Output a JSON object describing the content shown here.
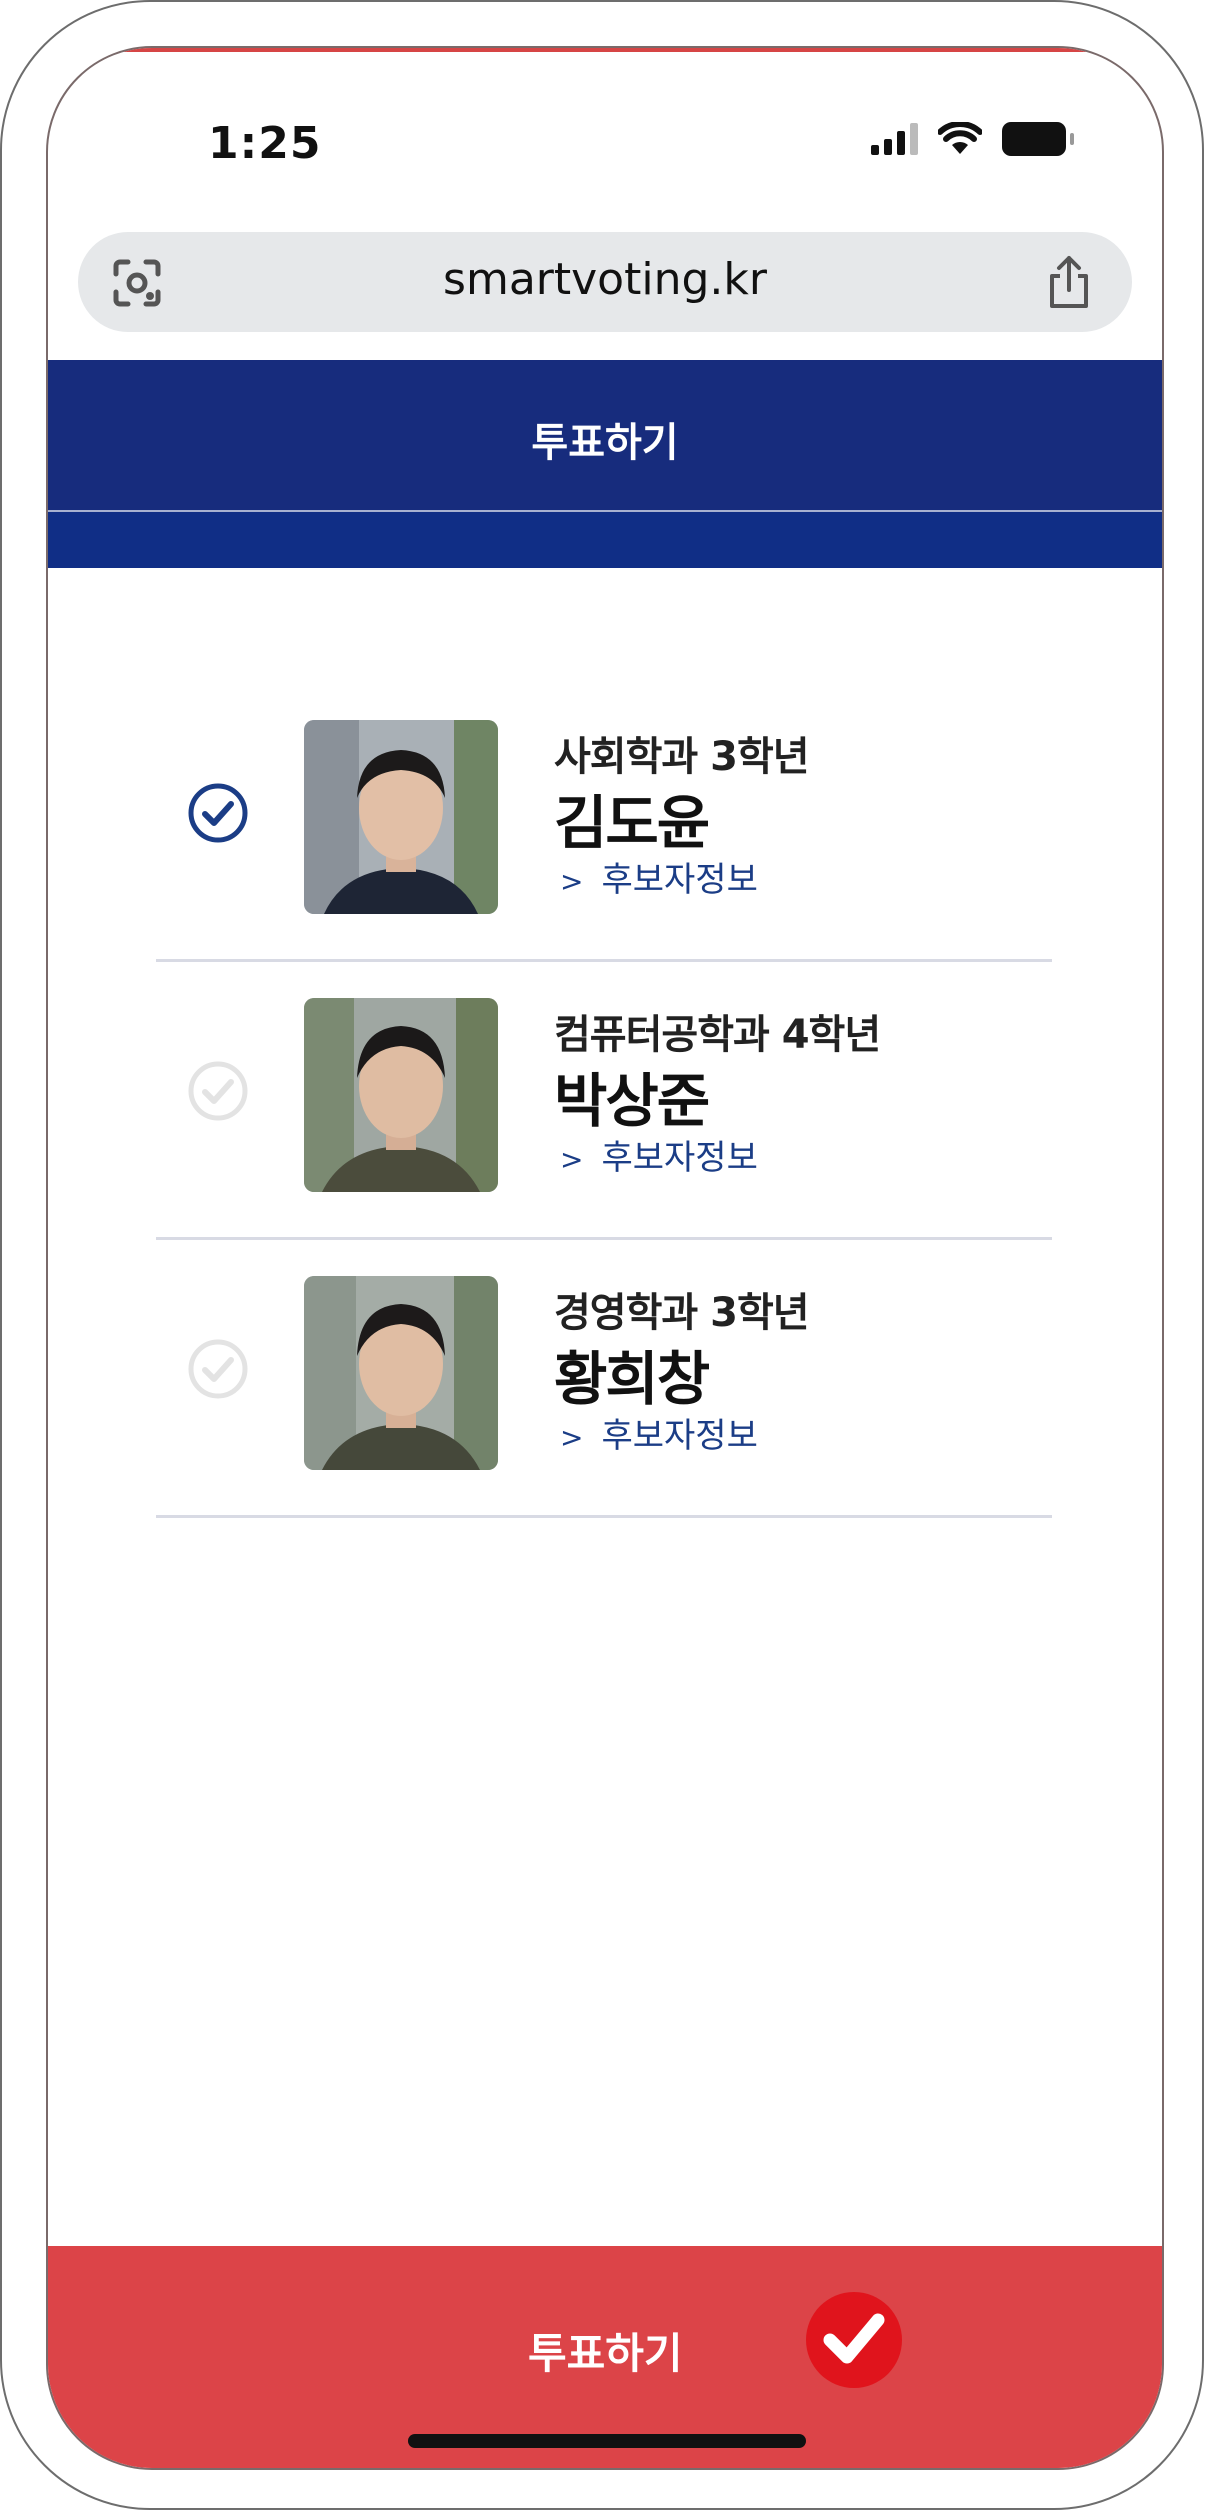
{
  "status_bar": {
    "time": "1:25"
  },
  "browser": {
    "url": "smartvoting.kr",
    "left_icon": "google-lens-icon",
    "right_icon": "share-icon"
  },
  "header": {
    "title": "투표하기"
  },
  "candidates": [
    {
      "department": "사회학과 3학년",
      "name": "김도윤",
      "info_link": "후보자정보",
      "selected": true
    },
    {
      "department": "컴퓨터공학과 4학년",
      "name": "박상준",
      "info_link": "후보자정보",
      "selected": false
    },
    {
      "department": "경영학과 3학년",
      "name": "황희창",
      "info_link": "후보자정보",
      "selected": false
    }
  ],
  "footer": {
    "vote_label": "투표하기"
  },
  "colors": {
    "header": "#172c7d",
    "subheader": "#102e86",
    "footer": "#dc4448",
    "accent": "#1b3d86",
    "check_badge": "#e0141c"
  }
}
